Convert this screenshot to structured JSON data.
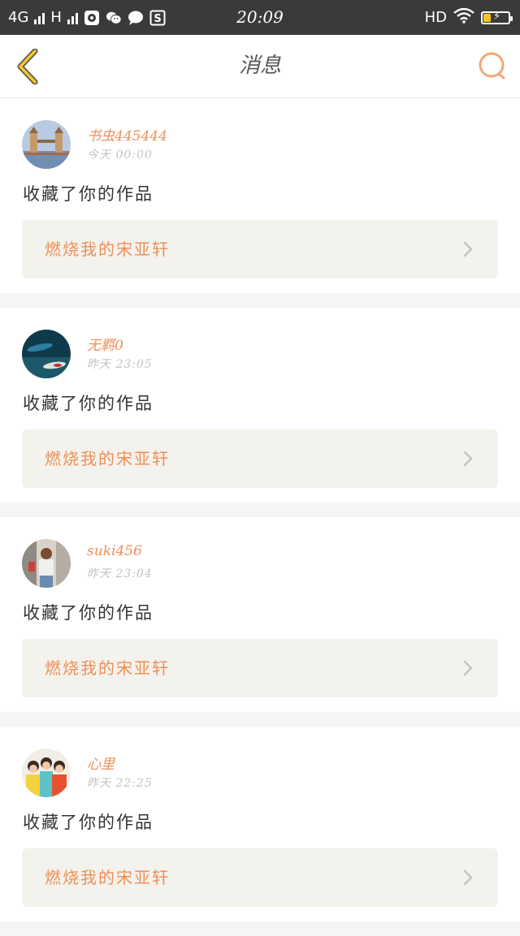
{
  "status_bar": {
    "network1": "4G",
    "network2": "H",
    "time": "20:09",
    "hd": "HD",
    "battery_level": 0.3,
    "icons": [
      "signal-icon",
      "photos-icon",
      "wechat-icon",
      "message-icon",
      "s-app-icon",
      "wifi-icon",
      "battery-icon"
    ]
  },
  "header": {
    "title": "消息",
    "back_icon": "chevron-left-icon",
    "search_icon": "search-icon"
  },
  "accent_color": "#ef8f58",
  "messages": [
    {
      "username": "书虫445444",
      "time": "今天  00:00",
      "action": "收藏了你的作品",
      "work_title": "燃烧我的宋亚轩"
    },
    {
      "username": "无羁0",
      "time": "昨天  23:05",
      "action": "收藏了你的作品",
      "work_title": "燃烧我的宋亚轩"
    },
    {
      "username": "suki456",
      "time": "昨天  23:04",
      "action": "收藏了你的作品",
      "work_title": "燃烧我的宋亚轩"
    },
    {
      "username": "心里",
      "time": "昨天  22:25",
      "action": "收藏了你的作品",
      "work_title": "燃烧我的宋亚轩"
    }
  ]
}
